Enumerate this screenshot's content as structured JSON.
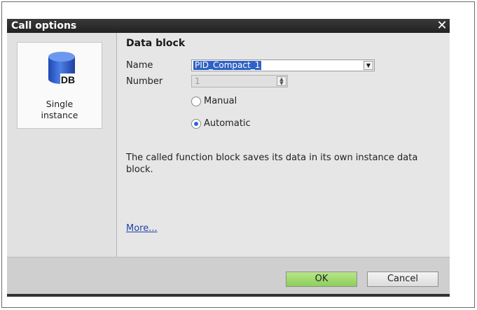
{
  "dialog": {
    "title": "Call options",
    "close_glyph": "✕"
  },
  "tile": {
    "icon_text": "DB",
    "label_line1": "Single",
    "label_line2": "instance"
  },
  "data_block": {
    "section_title": "Data block",
    "name_label": "Name",
    "name_value": "PID_Compact_1",
    "number_label": "Number",
    "number_value": "1",
    "radio_manual": "Manual",
    "radio_automatic": "Automatic",
    "selected_mode": "Automatic"
  },
  "description": "The called function block saves its data in its own instance data block.",
  "more_link": "More...",
  "buttons": {
    "ok": "OK",
    "cancel": "Cancel"
  },
  "colors": {
    "selection": "#2f62c5",
    "ok_button": "#8ccf58",
    "db_icon": "#2c58c8"
  }
}
